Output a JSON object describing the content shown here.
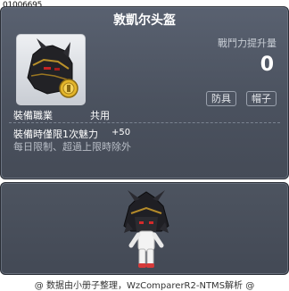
{
  "item_id": "01006695",
  "tooltip": {
    "title": "敦凱尔头盔",
    "stat_label": "戰鬥力提升量",
    "stat_value": "0",
    "tags": [
      "防具",
      "帽子"
    ],
    "job_label": "裝備職業",
    "job_value": "共用",
    "effect_label": "裝備時僅限1次魅力",
    "effect_value": "+50",
    "restriction": "每日限制、超過上限時除外"
  },
  "icons": {
    "item": "dark-helmet-with-gold-medal-icon",
    "character": "character-wearing-helmet-avatar"
  },
  "footer": "@ 数据由小册子整理，WzComparerR2-NTMS解析 @",
  "colors": {
    "panel": "#4b525f",
    "title": "#ffffff",
    "muted": "#c7ccd4"
  }
}
